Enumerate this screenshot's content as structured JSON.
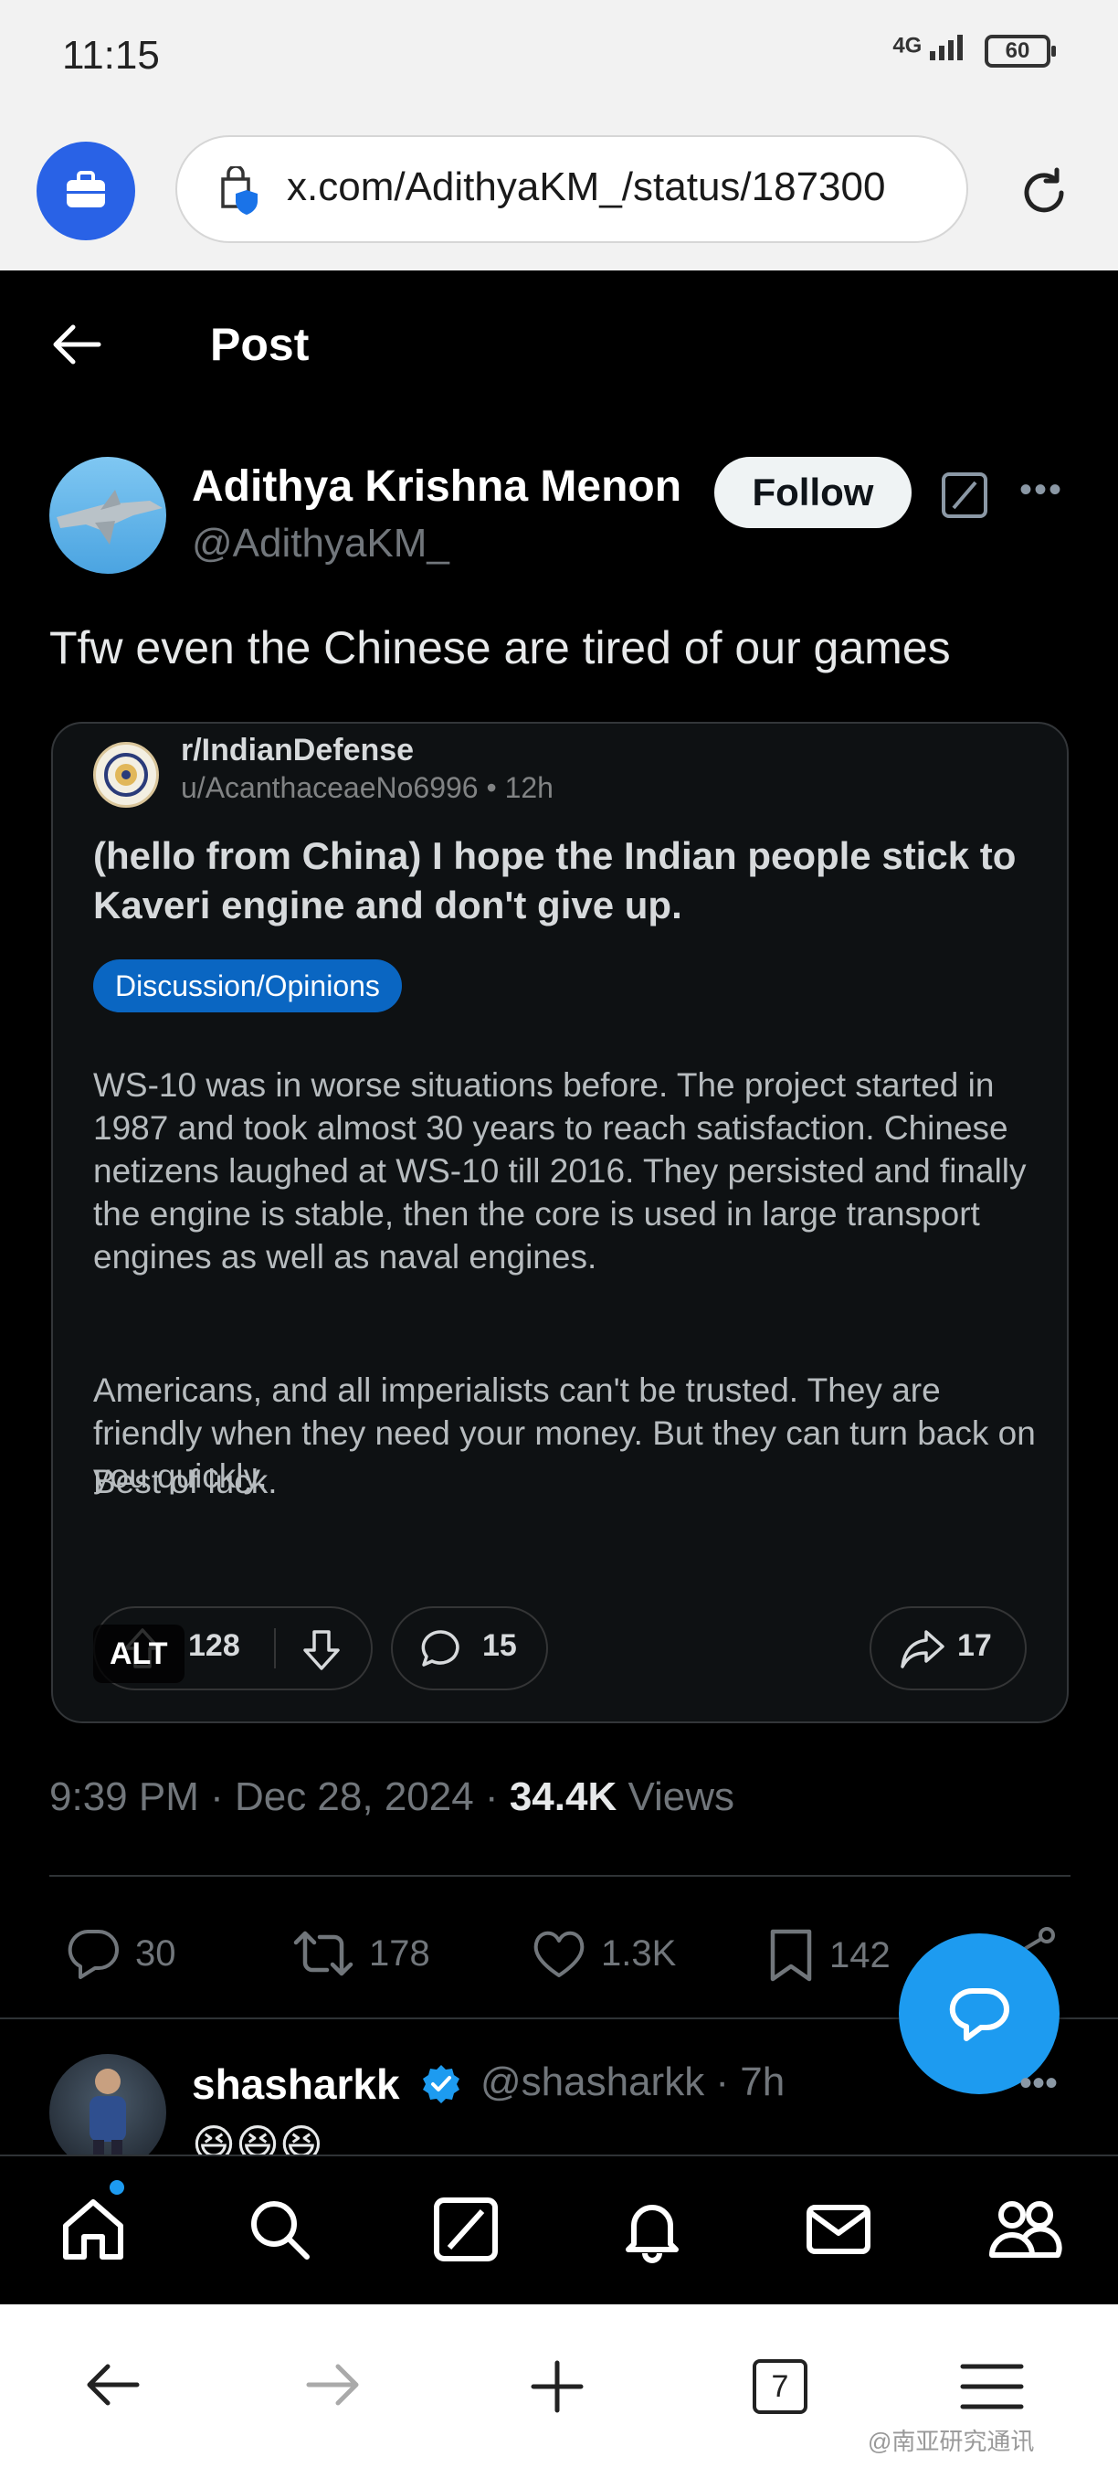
{
  "status_bar": {
    "time": "11:15",
    "network": "4G",
    "battery": "60"
  },
  "browser": {
    "url": "x.com/AdithyaKM_/status/187300",
    "tab_count": "7"
  },
  "header": {
    "title": "Post"
  },
  "post": {
    "author_name": "Adithya Krishna Menon",
    "author_handle": "@AdithyaKM_",
    "follow_label": "Follow",
    "text": "Tfw even the Chinese are tired of our games",
    "timestamp": "9:39 PM · Dec 28, 2024 · ",
    "views_count": "34.4K",
    "views_label": " Views",
    "stats": {
      "replies": "30",
      "reposts": "178",
      "likes": "1.3K",
      "bookmarks": "142"
    }
  },
  "embed": {
    "subreddit": "r/IndianDefense",
    "user_time": "u/AcanthaceaeNo6996 • 12h",
    "title": "(hello from China) I hope the Indian people stick to Kaveri engine and don't give up.",
    "flair": "Discussion/Opinions",
    "paragraphs": [
      "WS-10 was in worse situations before. The project started in 1987 and took almost 30 years to reach satisfaction. Chinese netizens laughed at WS-10 till 2016. They persisted and finally the engine is stable, then the core is used in large transport engines as well as naval engines.",
      "Americans, and all imperialists can't be trusted. They are friendly when they need your money. But they can turn back on you quickly.",
      "Best of luck."
    ],
    "votes": "128",
    "comments": "15",
    "shares": "17",
    "alt_badge": "ALT"
  },
  "reply": {
    "name": "shasharkk",
    "meta": "@shasharkk · 7h",
    "emoji": "😆😆😆"
  },
  "watermark": "@南亚研究通讯",
  "colors": {
    "accent": "#1d9bf0",
    "flair": "#0a66c2",
    "background": "#000000"
  }
}
